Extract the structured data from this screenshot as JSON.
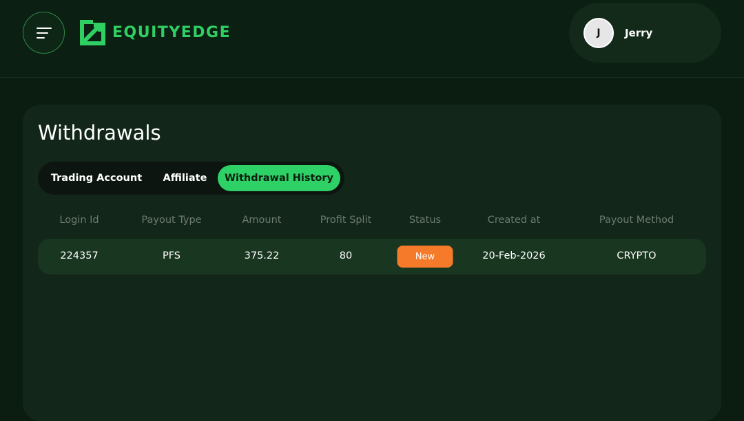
{
  "brand": {
    "name": "EQUITYEDGE",
    "color": "#2fcf63"
  },
  "header": {
    "menu_icon": "hamburger-icon",
    "user": {
      "initial": "J",
      "name": "Jerry"
    }
  },
  "page": {
    "title": "Withdrawals"
  },
  "tabs": [
    {
      "label": "Trading Account",
      "active": false
    },
    {
      "label": "Affiliate",
      "active": false
    },
    {
      "label": "Withdrawal History",
      "active": true
    }
  ],
  "table": {
    "columns": [
      "Login Id",
      "Payout Type",
      "Amount",
      "Profit Split",
      "Status",
      "Created at",
      "Payout Method"
    ],
    "rows": [
      {
        "login_id": "224357",
        "payout_type": "PFS",
        "amount": "375.22",
        "profit_split": "80",
        "status": "New",
        "created_at": "20-Feb-2026",
        "payout_method": "CRYPTO"
      }
    ]
  },
  "colors": {
    "accent": "#2ed165",
    "status_new": "#f57a2a",
    "background": "#0a1d10",
    "card": "#12271a"
  }
}
